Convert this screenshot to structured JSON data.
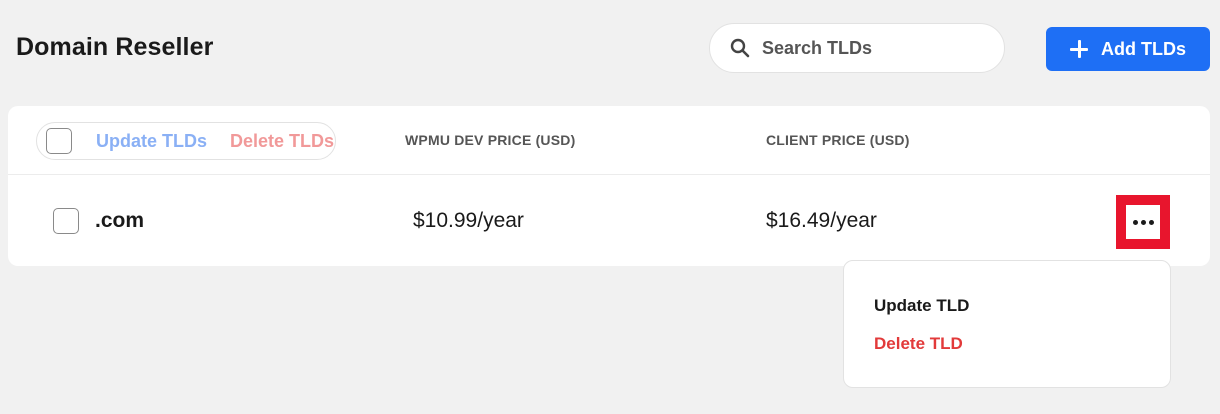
{
  "header": {
    "title": "Domain Reseller",
    "search_placeholder": "Search TLDs",
    "add_button_label": "Add TLDs"
  },
  "table": {
    "bulk_actions": {
      "update_label": "Update TLDs",
      "delete_label": "Delete TLDs"
    },
    "columns": [
      "WPMU DEV PRICE (USD)",
      "CLIENT PRICE (USD)"
    ],
    "rows": [
      {
        "tld": ".com",
        "wpmu_price": "$10.99/year",
        "client_price": "$16.49/year"
      }
    ]
  },
  "row_menu": {
    "items": [
      {
        "label": "Update TLD",
        "color": "#1a1a1a"
      },
      {
        "label": "Delete TLD",
        "color": "#e23a3a"
      }
    ]
  },
  "colors": {
    "accent": "#1e6ff5",
    "highlight_border": "#e8152d",
    "danger": "#e23a3a",
    "background": "#f1f1f1"
  },
  "icons": {
    "search": "search-icon",
    "add": "plus-icon",
    "more": "more-options-icon"
  }
}
